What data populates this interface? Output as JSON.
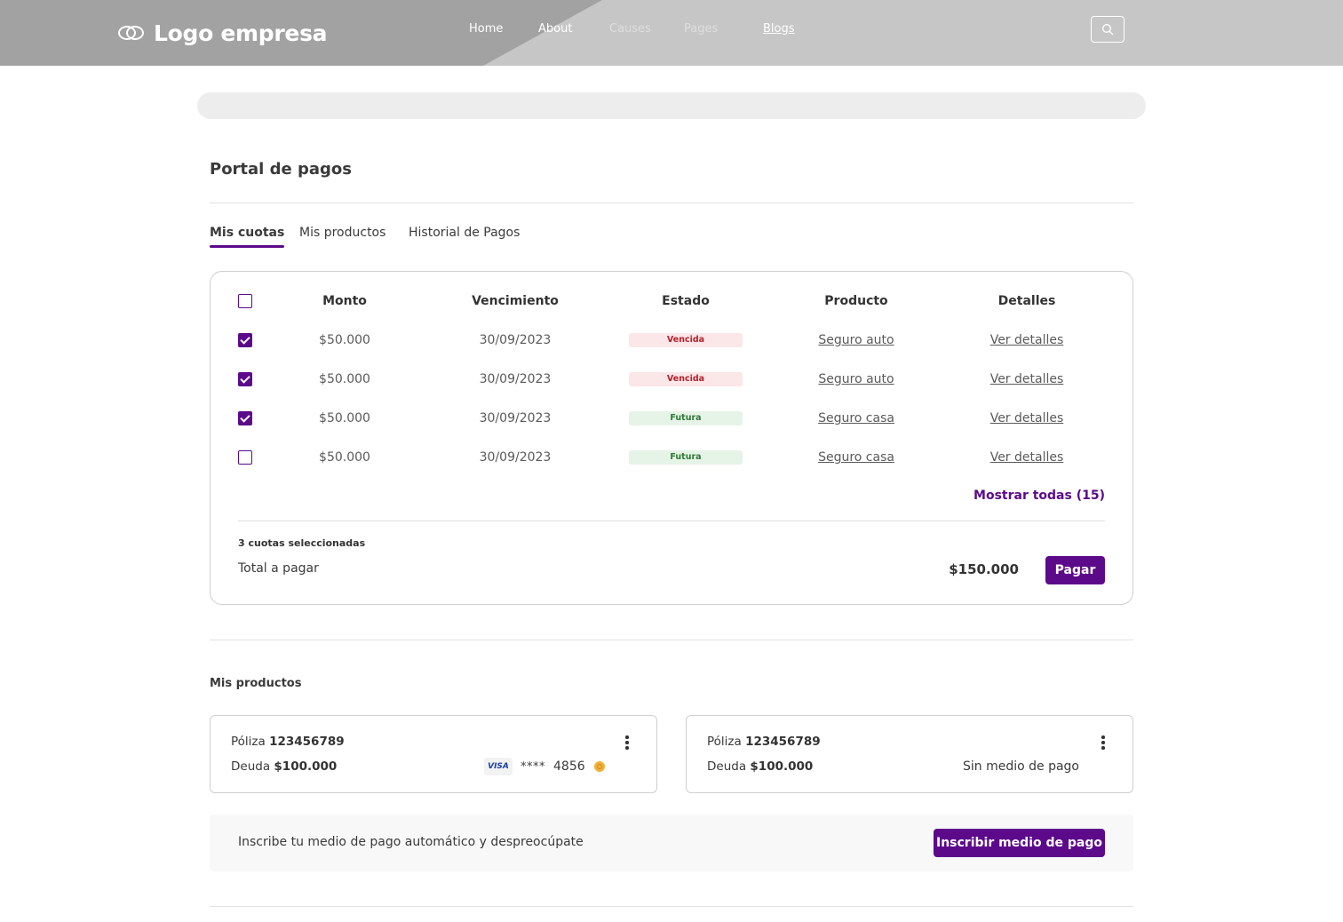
{
  "header": {
    "logo_text": "Logo empresa",
    "nav": [
      "Home",
      "About",
      "Causes",
      "Pages",
      "Blogs"
    ],
    "search_icon": "search-icon"
  },
  "page": {
    "title": "Portal de pagos",
    "tabs": [
      "Mis cuotas",
      "Mis productos",
      "Historial de Pagos"
    ]
  },
  "cuotas": {
    "headers": [
      "Monto",
      "Vencimiento",
      "Estado",
      "Producto",
      "Detalles"
    ],
    "rows": [
      {
        "checked": true,
        "monto": "$50.000",
        "vencimiento": "30/09/2023",
        "estado": "Vencida",
        "producto": "Seguro auto",
        "detalles": "Ver detalles"
      },
      {
        "checked": true,
        "monto": "$50.000",
        "vencimiento": "30/09/2023",
        "estado": "Vencida",
        "producto": "Seguro auto",
        "detalles": "Ver detalles"
      },
      {
        "checked": true,
        "monto": "$50.000",
        "vencimiento": "30/09/2023",
        "estado": "Futura",
        "producto": "Seguro casa",
        "detalles": "Ver detalles"
      },
      {
        "checked": false,
        "monto": "$50.000",
        "vencimiento": "30/09/2023",
        "estado": "Futura",
        "producto": "Seguro casa",
        "detalles": "Ver detalles"
      }
    ],
    "show_all": "Mostrar todas (15)",
    "selected_count": "3 cuotas seleccionadas",
    "total_label": "Total a pagar",
    "total_amount": "$150.000",
    "pay_button": "Pagar"
  },
  "productos": {
    "title": "Mis productos",
    "cards": [
      {
        "poliza_label": "Póliza",
        "poliza_number": "123456789",
        "deuda_label": "Deuda",
        "deuda_amount": "$100.000",
        "card_brand": "VISA",
        "card_masked": "****",
        "card_last4": "4856"
      },
      {
        "poliza_label": "Póliza",
        "poliza_number": "123456789",
        "deuda_label": "Deuda",
        "deuda_amount": "$100.000",
        "no_method": "Sin medio de pago"
      }
    ],
    "banner_text": "Inscribe tu medio de pago automático y despreocúpate",
    "banner_button": "Inscribir medio de pago"
  },
  "colors": {
    "accent": "#5c0a8a",
    "vencida_bg": "#fbe6e8",
    "vencida_text": "#b3212b",
    "futura_bg": "#e6f3e7",
    "futura_text": "#2d7a35"
  }
}
